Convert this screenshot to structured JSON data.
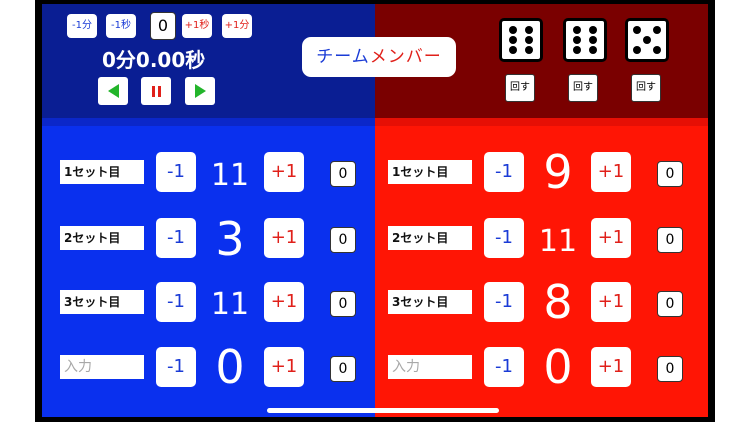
{
  "top_left": {
    "minus_min": "-1分",
    "minus_sec": "-1秒",
    "zero": "0",
    "plus_sec": "+1秒",
    "plus_min": "+1分",
    "timer": "0分0.00秒"
  },
  "team_button": {
    "part1": "チーム",
    "part2": "メンバー"
  },
  "dice": {
    "values": [
      6,
      6,
      5
    ],
    "roll_label": "回す"
  },
  "controls": {
    "minus": "-1",
    "plus": "+1"
  },
  "left_team": {
    "rows": [
      {
        "label": "1セット目",
        "score": "11",
        "zero": "0"
      },
      {
        "label": "2セット目",
        "score": "3",
        "zero": "0"
      },
      {
        "label": "3セット目",
        "score": "11",
        "zero": "0"
      },
      {
        "placeholder": "入力",
        "score": "0",
        "zero": "0"
      }
    ]
  },
  "right_team": {
    "rows": [
      {
        "label": "1セット目",
        "score": "9",
        "zero": "0"
      },
      {
        "label": "2セット目",
        "score": "11",
        "zero": "0"
      },
      {
        "label": "3セット目",
        "score": "8",
        "zero": "0"
      },
      {
        "placeholder": "入力",
        "score": "0",
        "zero": "0"
      }
    ]
  },
  "colors": {
    "left_top": "#0a1e93",
    "left_bottom": "#0a30ee",
    "right_top": "#7a0000",
    "right_bottom": "#ff1505",
    "accent_blue": "#1a3bd6",
    "accent_red": "#e0201a",
    "play_green": "#23b52b"
  },
  "icons": [
    "rewind-icon",
    "pause-icon",
    "play-icon",
    "die-icon"
  ]
}
